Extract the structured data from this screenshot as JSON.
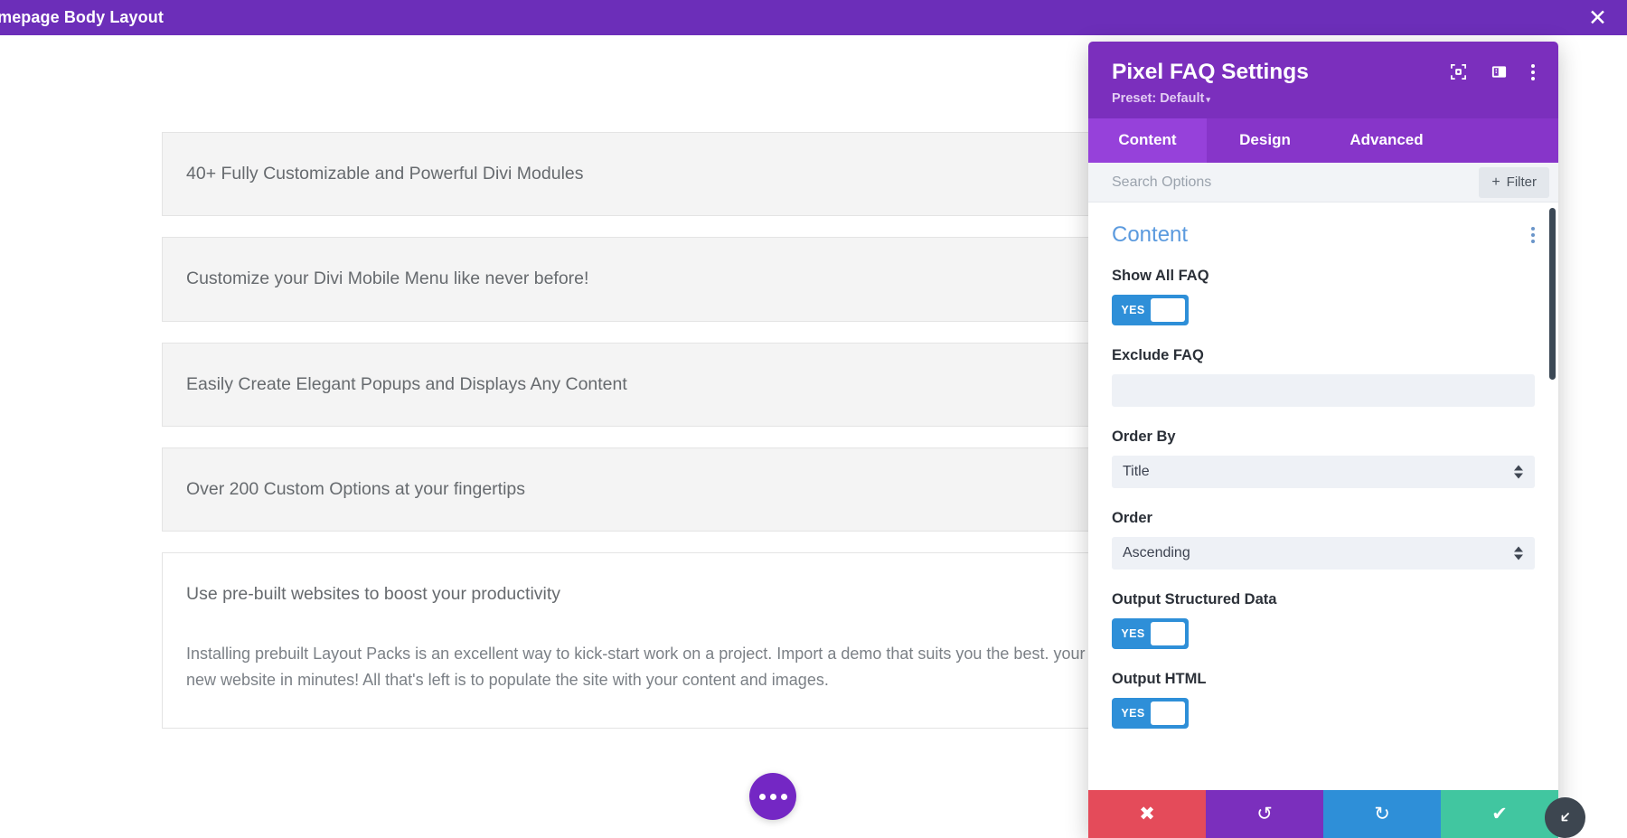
{
  "top_bar": {
    "title": "omepage Body Layout",
    "close_icon": "close-icon"
  },
  "canvas": {
    "faq_items": [
      {
        "title": "40+ Fully Customizable and Powerful Divi Modules",
        "body": ""
      },
      {
        "title": "Customize your Divi Mobile Menu like never before!",
        "body": ""
      },
      {
        "title": "Easily Create Elegant Popups and Displays Any Content",
        "body": ""
      },
      {
        "title": "Over 200 Custom Options at your fingertips",
        "body": ""
      },
      {
        "title": "Use pre-built websites to boost your productivity",
        "body": "Installing prebuilt Layout Packs is an excellent way to kick-start work on a project. Import a demo that suits you the best. your new website in minutes! All that's left is to populate the site with your content and images."
      }
    ],
    "page_settings_button": "page-settings-button"
  },
  "settings_panel": {
    "title": "Pixel FAQ Settings",
    "preset_label": "Preset: Default",
    "preset_caret": "▾",
    "header_icons": [
      "focus-target-icon",
      "panel-layout-icon",
      "kebab-menu-icon"
    ],
    "tabs": [
      {
        "label": "Content",
        "active": true
      },
      {
        "label": "Design",
        "active": false
      },
      {
        "label": "Advanced",
        "active": false
      }
    ],
    "search": {
      "placeholder": "Search Options",
      "value": ""
    },
    "filter_button": {
      "plus": "+",
      "label": "Filter"
    },
    "section": {
      "title": "Content",
      "kebab": "section-kebab-icon"
    },
    "fields": [
      {
        "label": "Show All FAQ",
        "type": "toggle",
        "value": "YES"
      },
      {
        "label": "Exclude FAQ",
        "type": "text",
        "value": "",
        "placeholder": ""
      },
      {
        "label": "Order By",
        "type": "select",
        "value": "Title"
      },
      {
        "label": "Order",
        "type": "select",
        "value": "Ascending"
      },
      {
        "label": "Output Structured Data",
        "type": "toggle",
        "value": "YES"
      },
      {
        "label": "Output HTML",
        "type": "toggle",
        "value": "YES"
      }
    ],
    "footer_buttons": [
      {
        "name": "cancel-button",
        "icon": "✖"
      },
      {
        "name": "undo-button",
        "icon": "↺"
      },
      {
        "name": "redo-button",
        "icon": "↻"
      },
      {
        "name": "save-button",
        "icon": "✔"
      }
    ],
    "colors": {
      "header_purple": "#7b2fbd",
      "tabs_purple": "#8735c9",
      "tab_active_purple": "#9641da",
      "section_title_blue": "#5b9ade",
      "toggle_blue": "#2e8fd8",
      "cancel_red": "#e44b5a",
      "undo_purple": "#7b2fbd",
      "redo_blue": "#2e8fd8",
      "save_green": "#41c6a0",
      "top_bar_purple": "#6c2eb9"
    }
  }
}
